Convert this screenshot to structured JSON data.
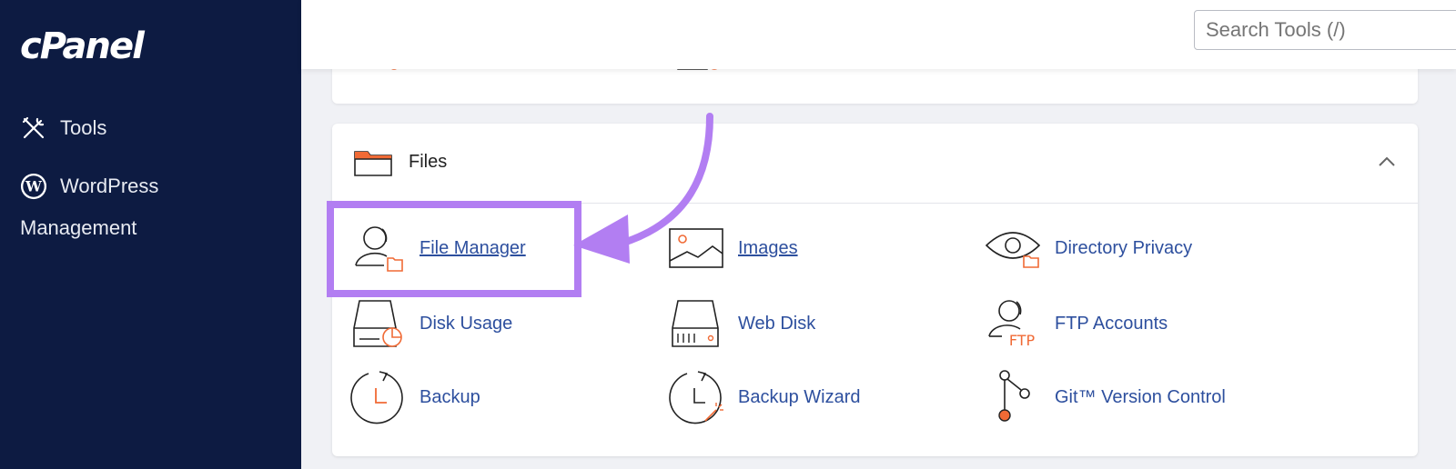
{
  "sidebar": {
    "logo": "cPanel",
    "items": [
      {
        "label": "Tools",
        "icon": "tools-icon"
      },
      {
        "label": "WordPress",
        "sublabel": "Management",
        "icon": "wordpress-icon"
      }
    ]
  },
  "search": {
    "placeholder": "Search Tools (/)"
  },
  "files_section": {
    "title": "Files",
    "tools": [
      {
        "label": "File Manager",
        "icon": "file-manager-icon"
      },
      {
        "label": "Images",
        "icon": "images-icon"
      },
      {
        "label": "Directory Privacy",
        "icon": "directory-privacy-icon"
      },
      {
        "label": "Disk Usage",
        "icon": "disk-usage-icon"
      },
      {
        "label": "Web Disk",
        "icon": "web-disk-icon"
      },
      {
        "label": "FTP Accounts",
        "icon": "ftp-accounts-icon",
        "badge": "FTP"
      },
      {
        "label": "Backup",
        "icon": "backup-icon"
      },
      {
        "label": "Backup Wizard",
        "icon": "backup-wizard-icon"
      },
      {
        "label": "Git™ Version Control",
        "icon": "git-icon"
      }
    ]
  },
  "colors": {
    "sidebar_bg": "#0d1b42",
    "link": "#2d4f9e",
    "accent_orange": "#f06a35",
    "highlight_purple": "#b27ef2"
  }
}
